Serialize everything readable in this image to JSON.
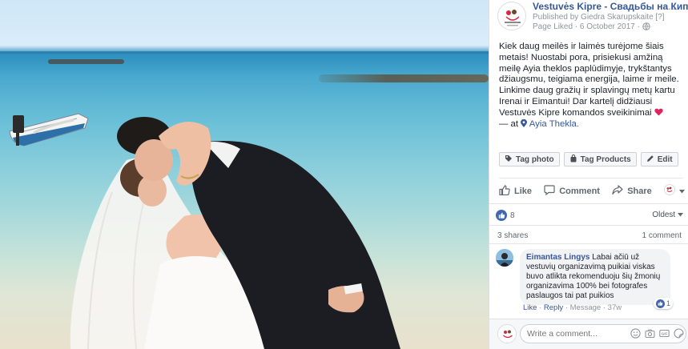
{
  "post": {
    "page_name": "Vestuvės Kipre - Свадьбы на Кипре",
    "published_by": "Published by Giedra Skarupskaite [?]",
    "page_liked": "Page Liked · 6 October 2017 ·",
    "more": "···",
    "text": "Kiek daug meilės ir laimės turėjome šiais metais! Nuostabi pora, prisiekusi amžiną meilę Ayia theklos paplūdimyje, trykštantys džiaugsmu, teigiama energija, laime ir meile. Linkime daug gražių ir splavingų metų kartu Irenai ir Eimantui! Dar kartelį didžiausi Vestuvės Kipre komandos sveikinimai",
    "location_prefix": "— at",
    "location": "Ayia Thekla."
  },
  "tag_buttons": {
    "tag_photo": "Tag photo",
    "tag_products": "Tag Products",
    "edit": "Edit"
  },
  "actions": {
    "like": "Like",
    "comment": "Comment",
    "share": "Share"
  },
  "stats": {
    "reactions_count": "8",
    "sort": "Oldest",
    "shares": "3 shares",
    "comments": "1 comment"
  },
  "comment": {
    "author": "Eimantas Lingys",
    "text": "Labai ačiū už vestuvių organizavimą puikiai viskas buvo atlikta rekomenduoju šių žmonių organizavima 100% bei fotografes paslaugos tai pat puikios",
    "like_count": "1",
    "like": "Like",
    "reply": "Reply",
    "message": "Message",
    "time": "37w"
  },
  "composer": {
    "placeholder": "Write a comment..."
  },
  "colors": {
    "link": "#365899",
    "like_blue": "#4267b2",
    "heart": "#e0245e"
  }
}
